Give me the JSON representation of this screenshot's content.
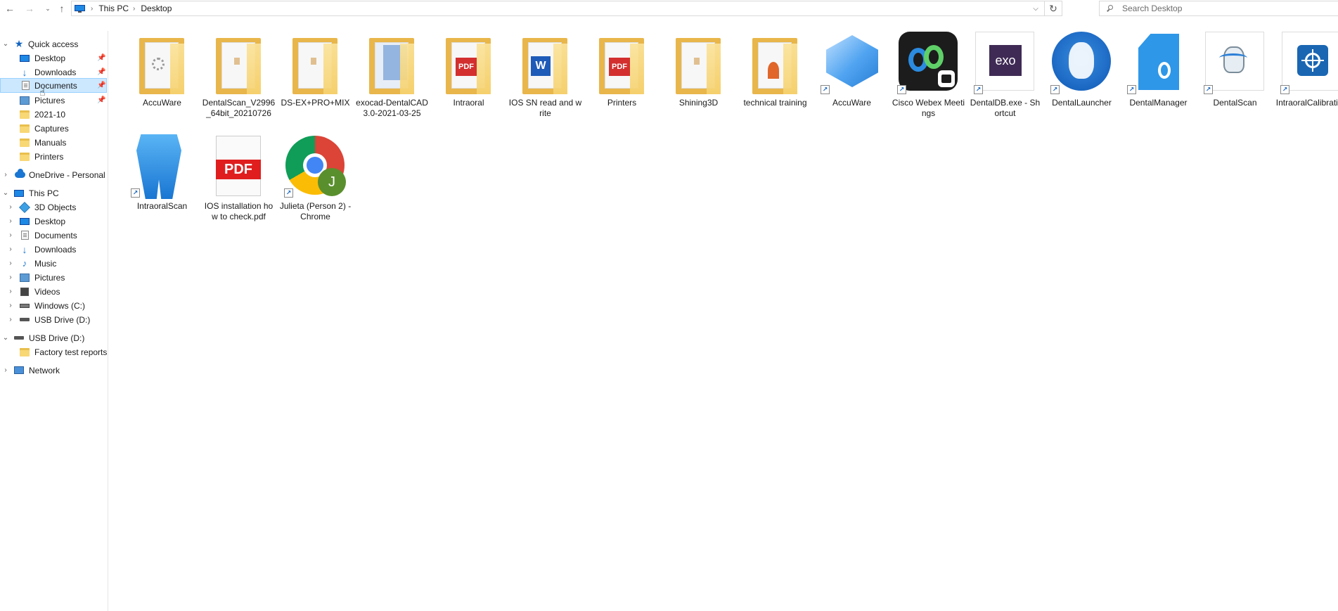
{
  "address": {
    "crumbs": [
      "This PC",
      "Desktop"
    ]
  },
  "search": {
    "placeholder": "Search Desktop"
  },
  "nav": {
    "quick_access": "Quick access",
    "quick_items": [
      {
        "label": "Desktop",
        "pinned": true
      },
      {
        "label": "Downloads",
        "pinned": true
      },
      {
        "label": "Documents",
        "pinned": true,
        "selected": true
      },
      {
        "label": "Pictures",
        "pinned": true
      },
      {
        "label": "2021-10"
      },
      {
        "label": "Captures"
      },
      {
        "label": "Manuals"
      },
      {
        "label": "Printers"
      }
    ],
    "onedrive": "OneDrive - Personal",
    "this_pc": "This PC",
    "pc_items": [
      "3D Objects",
      "Desktop",
      "Documents",
      "Downloads",
      "Music",
      "Pictures",
      "Videos",
      "Windows (C:)",
      "USB Drive (D:)"
    ],
    "usb": "USB Drive (D:)",
    "usb_items": [
      "Factory test reports"
    ],
    "network": "Network"
  },
  "files": [
    {
      "name": "AccuWare",
      "kind": "folder"
    },
    {
      "name": "DentalScan_V2996_64bit_20210726",
      "kind": "folder"
    },
    {
      "name": "DS-EX+PRO+MIX",
      "kind": "folder"
    },
    {
      "name": "exocad-DentalCAD3.0-2021-03-25",
      "kind": "folder"
    },
    {
      "name": "Intraoral",
      "kind": "folder-pdf"
    },
    {
      "name": "IOS SN read and write",
      "kind": "folder-word"
    },
    {
      "name": "Printers",
      "kind": "folder-pdf"
    },
    {
      "name": "Shining3D",
      "kind": "folder"
    },
    {
      "name": "technical training",
      "kind": "folder-ppt"
    },
    {
      "name": "AccuWare",
      "kind": "app-accuware"
    },
    {
      "name": "Cisco Webex Meetings",
      "kind": "app-webex"
    },
    {
      "name": "DentalDB.exe - Shortcut",
      "kind": "app-exo"
    },
    {
      "name": "DentalLauncher",
      "kind": "app-launcher"
    },
    {
      "name": "DentalManager",
      "kind": "app-manager"
    },
    {
      "name": "DentalScan",
      "kind": "app-dentalscan"
    },
    {
      "name": "IntraoralCalibration",
      "kind": "app-calib"
    },
    {
      "name": "IntraoralScan",
      "kind": "app-intraoral"
    },
    {
      "name": "IOS installation how to check.pdf",
      "kind": "pdf"
    },
    {
      "name": "Julieta (Person 2) - Chrome",
      "kind": "app-chrome",
      "badge": "J"
    }
  ],
  "icons": {
    "pdf_label": "PDF",
    "word_label": "W",
    "exo_label": "exo"
  }
}
